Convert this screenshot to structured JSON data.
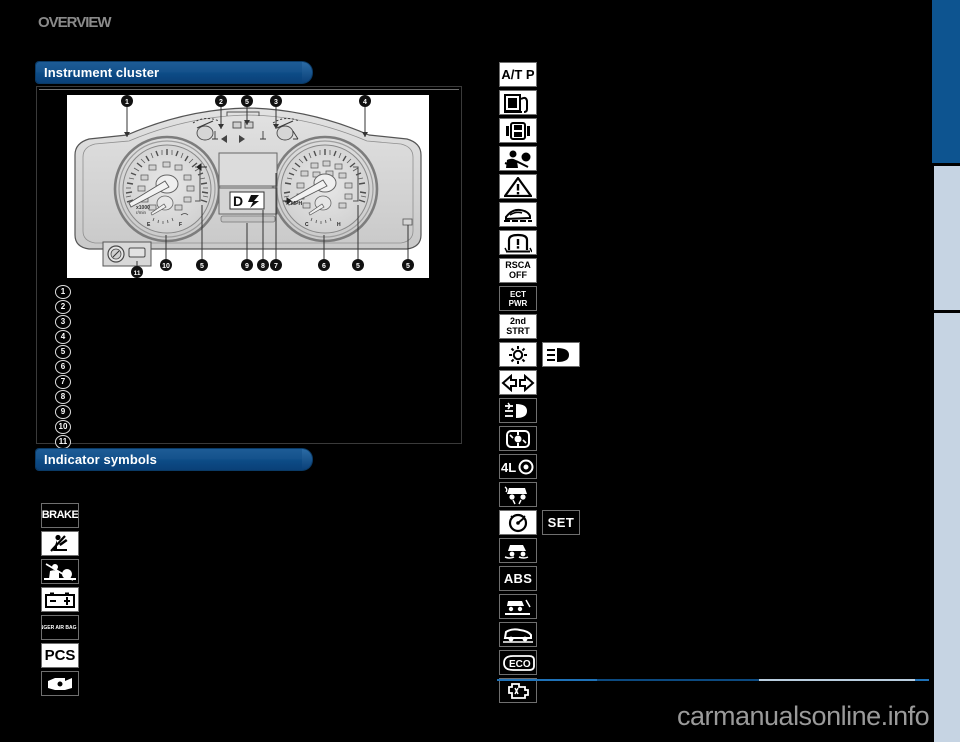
{
  "page": {
    "running_head": "OVERVIEW",
    "background_color": "#000000",
    "watermark": "carmanualsonline.info"
  },
  "sections": [
    {
      "id": "instrument-cluster",
      "title": "Instrument cluster"
    },
    {
      "id": "indicator-symbols",
      "title": "Indicator symbols"
    }
  ],
  "figure": {
    "caption": "",
    "callout_numbers": [
      "1",
      "2",
      "5",
      "3",
      "4",
      "10",
      "5",
      "9",
      "8",
      "7",
      "6",
      "5",
      "5",
      "11"
    ],
    "labels_top": [
      "1",
      "2",
      "5",
      "3",
      "4"
    ],
    "labels_bottom": [
      "11",
      "10",
      "5",
      "9",
      "8",
      "7",
      "6",
      "5",
      "5"
    ],
    "gauge_left_text": "x1000 r/min",
    "gauge_left_fuel": [
      "E",
      "F"
    ],
    "gauge_right_text": "MPH",
    "gauge_right_temp": [
      "C",
      "H"
    ],
    "shift_display": "D"
  },
  "callout_list": {
    "items": [
      {
        "num": "1",
        "text": ""
      },
      {
        "num": "2",
        "text": ""
      },
      {
        "num": "3",
        "text": ""
      },
      {
        "num": "4",
        "text": ""
      },
      {
        "num": "5",
        "text": ""
      },
      {
        "num": "6",
        "text": ""
      },
      {
        "num": "7",
        "text": ""
      },
      {
        "num": "8",
        "text": ""
      },
      {
        "num": "9",
        "text": ""
      },
      {
        "num": "10",
        "text": ""
      },
      {
        "num": "11",
        "text": ""
      }
    ]
  },
  "indicator_symbols": {
    "left_column": [
      {
        "id": "brake-warning",
        "kind": "text-inverse",
        "label": "BRAKE",
        "description": ""
      },
      {
        "id": "seat-belt-reminder",
        "kind": "glyph",
        "label": "",
        "description": ""
      },
      {
        "id": "srs-airbag-warning",
        "kind": "glyph-inverse",
        "label": "",
        "description": ""
      },
      {
        "id": "charging-system-battery",
        "kind": "glyph",
        "label": "",
        "description": ""
      },
      {
        "id": "passenger-airbag-on-off",
        "kind": "text-inverse",
        "label": "PASSENGER AIR BAG ON OFF",
        "description": ""
      },
      {
        "id": "pcs-warning",
        "kind": "text",
        "label": "PCS",
        "description": ""
      },
      {
        "id": "open-door-warning",
        "kind": "glyph-inverse",
        "label": "",
        "description": ""
      }
    ],
    "right_column": [
      {
        "id": "atp-indicator",
        "kind": "text",
        "label": "A/T P",
        "description": ""
      },
      {
        "id": "low-fuel-level",
        "kind": "glyph",
        "label": "",
        "description": ""
      },
      {
        "id": "door-ajar",
        "kind": "glyph",
        "label": "",
        "description": ""
      },
      {
        "id": "srs-side-airbag",
        "kind": "glyph",
        "label": "",
        "description": ""
      },
      {
        "id": "master-warning",
        "kind": "glyph",
        "label": "",
        "description": ""
      },
      {
        "id": "low-washer-fluid",
        "kind": "glyph",
        "label": "",
        "description": ""
      },
      {
        "id": "tire-pressure-warning",
        "kind": "glyph",
        "label": "",
        "description": ""
      },
      {
        "id": "rsca-off",
        "kind": "text",
        "label": "RSCA OFF",
        "description": ""
      },
      {
        "id": "ect-pwr",
        "kind": "text-inverse",
        "label": "ECT PWR",
        "description": ""
      },
      {
        "id": "second-start",
        "kind": "text",
        "label": "2nd STRT",
        "description": ""
      },
      {
        "id": "tail-light",
        "kind": "glyph",
        "label": "",
        "description": "",
        "pair": {
          "id": "headlight-high-beam",
          "kind": "glyph"
        }
      },
      {
        "id": "turn-signal",
        "kind": "glyph",
        "label": "",
        "description": ""
      },
      {
        "id": "fog-light",
        "kind": "glyph",
        "label": "",
        "description": ""
      },
      {
        "id": "center-diff-lock",
        "kind": "glyph",
        "label": "",
        "description": ""
      },
      {
        "id": "four-wheel-low",
        "kind": "text",
        "label": "4LO",
        "description": ""
      },
      {
        "id": "vsc-trac-off",
        "kind": "glyph",
        "label": "",
        "description": ""
      },
      {
        "id": "cruise-control",
        "kind": "glyph",
        "label": "",
        "description": "",
        "pair": {
          "id": "cruise-set",
          "kind": "text-inverse",
          "label": "SET"
        }
      },
      {
        "id": "slip-indicator",
        "kind": "glyph-inverse",
        "label": "",
        "description": ""
      },
      {
        "id": "abs-warning",
        "kind": "text-inverse",
        "label": "ABS",
        "description": ""
      },
      {
        "id": "downhill-assist",
        "kind": "glyph-inverse",
        "label": "",
        "description": ""
      },
      {
        "id": "crawl-control",
        "kind": "glyph-inverse",
        "label": "",
        "description": ""
      },
      {
        "id": "eco-driving",
        "kind": "text-inverse",
        "label": "ECO",
        "description": ""
      },
      {
        "id": "engine-malfunction",
        "kind": "glyph-inverse",
        "label": "",
        "description": ""
      }
    ]
  },
  "edge_tabs": [
    {
      "id": "tab-section-1",
      "color": "#0d5490"
    },
    {
      "id": "tab-section-2",
      "color": "#c6d4e3"
    },
    {
      "id": "tab-section-3",
      "color": "#c6d4e3"
    }
  ],
  "colors": {
    "section_bar": "#0d5490",
    "section_bar_dark": "#0a4078",
    "tab_pale": "#c6d4e3",
    "rule": "#1a6fb5",
    "watermark": "#9a9a9a",
    "head_text": "#8a8a8a"
  }
}
